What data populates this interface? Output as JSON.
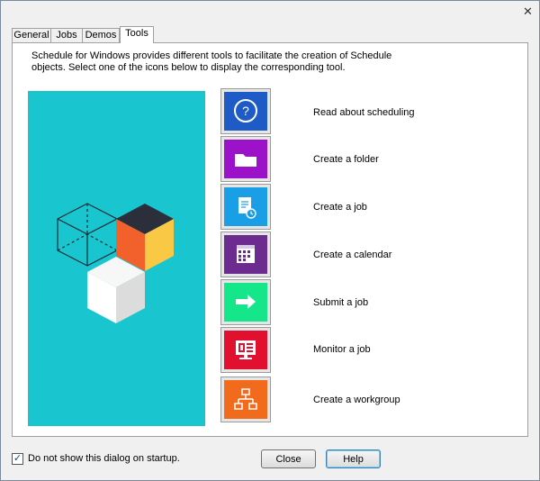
{
  "tabs": [
    {
      "label": "General",
      "active": false
    },
    {
      "label": "Jobs",
      "active": false
    },
    {
      "label": "Demos",
      "active": false
    },
    {
      "label": "Tools",
      "active": true
    }
  ],
  "description": "Schedule for Windows provides different tools to facilitate the creation of Schedule objects. Select one of the icons below to display the corresponding tool.",
  "tools": [
    {
      "label": "Read about scheduling",
      "icon": "help-icon",
      "color": "#1e5bc6"
    },
    {
      "label": "Create a folder",
      "icon": "folder-icon",
      "color": "#9b12c9"
    },
    {
      "label": "Create a job",
      "icon": "job-icon",
      "color": "#1a9ee6"
    },
    {
      "label": "Create a calendar",
      "icon": "calendar-icon",
      "color": "#6b2b8f"
    },
    {
      "label": "Submit a job",
      "icon": "arrow-right-icon",
      "color": "#15e68a"
    },
    {
      "label": "Monitor a job",
      "icon": "monitor-icon",
      "color": "#e0102e"
    },
    {
      "label": "Create a workgroup",
      "icon": "workgroup-icon",
      "color": "#f26a1b"
    }
  ],
  "footer": {
    "checkbox_label": "Do not show this dialog on startup.",
    "checkbox_checked": true,
    "close_label": "Close",
    "help_label": "Help"
  },
  "title_close_glyph": "✕",
  "check_glyph": "✓",
  "illustration_color": "#19c6cf"
}
